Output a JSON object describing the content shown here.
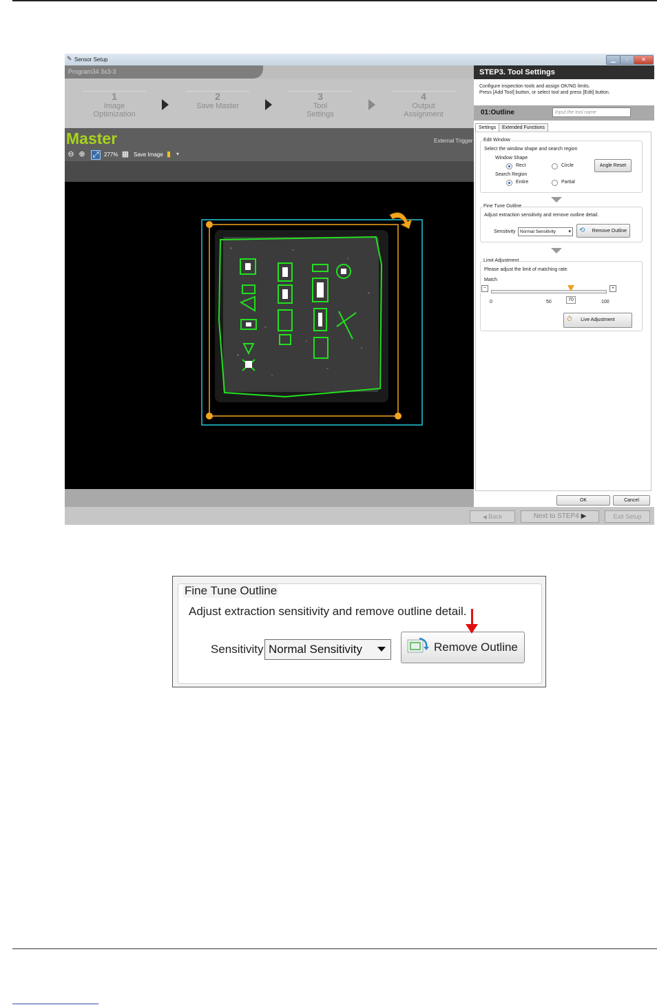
{
  "window": {
    "title": "Sensor Setup",
    "program": "Program34   3x3-3"
  },
  "steps": [
    {
      "num": "1",
      "label": "Image\nOptimization"
    },
    {
      "num": "2",
      "label": "Save Master"
    },
    {
      "num": "3",
      "label": "Tool\nSettings"
    },
    {
      "num": "4",
      "label": "Output\nAssignment"
    }
  ],
  "viewer": {
    "title": "Master",
    "trigger": "External Trigger",
    "zoom": "277%",
    "save_image": "Save Image"
  },
  "panel": {
    "step_title": "STEP3. Tool Settings",
    "desc_line1": "Configure inspection tools and assign OK/NG limits.",
    "desc_line2": "Press [Add Tool] button, or select tool and press [Edit] button.",
    "tool_name": "01:Outline",
    "tool_name_placeholder": "Input the tool name",
    "tabs": [
      "Settings",
      "Extended Functions"
    ],
    "edit_window": {
      "title": "Edit Window",
      "desc": "Select the window shape and search region",
      "shape_label": "Window Shape",
      "shape_options": [
        "Rect",
        "Circle"
      ],
      "shape_selected": "Rect",
      "region_label": "Search Region",
      "region_options": [
        "Entire",
        "Partial"
      ],
      "region_selected": "Entire",
      "angle_reset": "Angle Reset"
    },
    "fine_tune": {
      "title": "Fine Tune Outline",
      "desc": "Adjust extraction sensitivity and remove outline detail.",
      "sensitivity_label": "Sensitivity",
      "sensitivity_value": "Normal Sensitivity",
      "remove_button": "Remove Outline"
    },
    "limit": {
      "title": "Limit Adjustment",
      "desc": "Please adjust the limit of matching rate.",
      "match_label": "Match",
      "minus": "−",
      "plus": "+",
      "value": "70",
      "ticks": [
        "0",
        "50",
        "100"
      ],
      "live_button": "Live Adjustment"
    },
    "ok": "OK",
    "cancel": "Cancel"
  },
  "footer": {
    "back": "Back",
    "next": "Next to STEP4",
    "exit": "Exit Setup"
  },
  "callout": {
    "title": "Fine Tune Outline",
    "desc": "Adjust extraction sensitivity and remove outline detail.",
    "sensitivity_label": "Sensitivity",
    "sensitivity_value": "Normal Sensitivity",
    "remove_button": "Remove Outline"
  },
  "colors": {
    "master_green": "#a6d41a",
    "outline_green": "#22e020",
    "window_orange": "#f2a41e",
    "search_cyan": "#22c8d8",
    "arrow_red": "#e01010"
  }
}
